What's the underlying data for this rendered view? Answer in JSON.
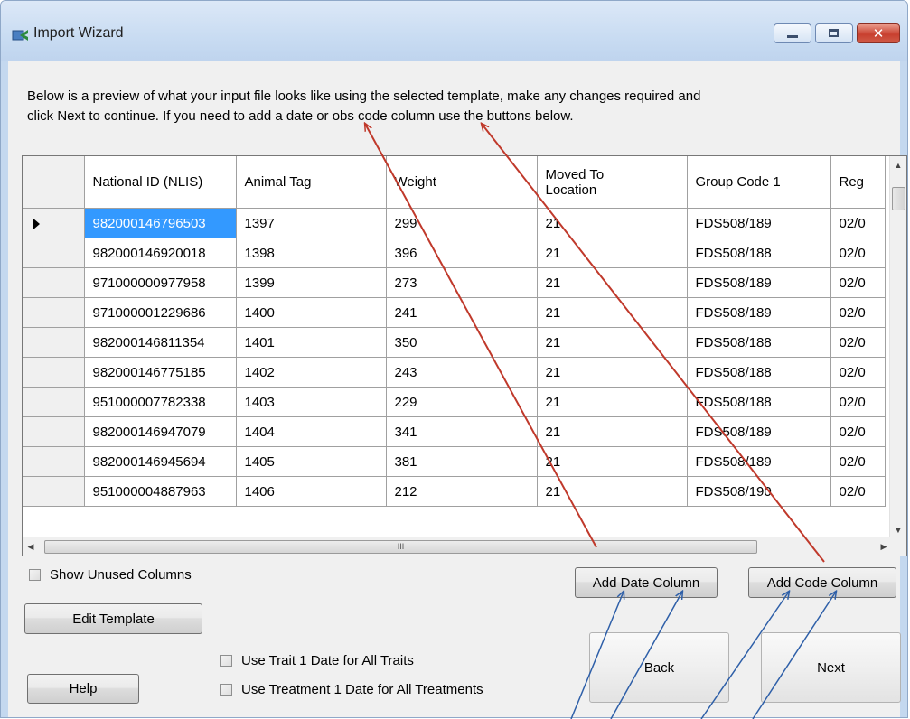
{
  "window": {
    "title": "Import Wizard",
    "icons": {
      "app": "import-wizard-icon",
      "minimize": "minimize-icon",
      "maximize": "maximize-icon",
      "close": "close-icon"
    }
  },
  "intro": {
    "line1": "Below is a preview of what your input file looks like using the selected template, make any changes required and",
    "line2": "click Next to continue. If you need to add a date or obs code column use the buttons below."
  },
  "grid": {
    "columns": [
      "National ID (NLIS)",
      "Animal Tag",
      "Weight",
      "Moved To Location",
      "Group Code 1",
      "Reg"
    ],
    "rows": [
      [
        "982000146796503",
        "1397",
        "299",
        "21",
        "FDS508/189",
        "02/0"
      ],
      [
        "982000146920018",
        "1398",
        "396",
        "21",
        "FDS508/188",
        "02/0"
      ],
      [
        "971000000977958",
        "1399",
        "273",
        "21",
        "FDS508/189",
        "02/0"
      ],
      [
        "971000001229686",
        "1400",
        "241",
        "21",
        "FDS508/189",
        "02/0"
      ],
      [
        "982000146811354",
        "1401",
        "350",
        "21",
        "FDS508/188",
        "02/0"
      ],
      [
        "982000146775185",
        "1402",
        "243",
        "21",
        "FDS508/188",
        "02/0"
      ],
      [
        "951000007782338",
        "1403",
        "229",
        "21",
        "FDS508/188",
        "02/0"
      ],
      [
        "982000146947079",
        "1404",
        "341",
        "21",
        "FDS508/189",
        "02/0"
      ],
      [
        "982000146945694",
        "1405",
        "381",
        "21",
        "FDS508/189",
        "02/0"
      ],
      [
        "951000004887963",
        "1406",
        "212",
        "21",
        "FDS508/190",
        "02/0"
      ]
    ],
    "selected_row": 0,
    "hscroll_grip": "III"
  },
  "controls": {
    "show_unused_columns": "Show Unused Columns",
    "edit_template": "Edit Template",
    "add_date_column": "Add Date Column",
    "add_code_column": "Add Code Column",
    "use_trait_date": "Use Trait 1 Date for All Traits",
    "use_treatment_date": "Use Treatment 1 Date for All Treatments",
    "help": "Help",
    "back": "Back",
    "next": "Next"
  },
  "annotation_colors": {
    "red_arrow": "#c0392b",
    "blue_arrow": "#2e5fa8"
  }
}
